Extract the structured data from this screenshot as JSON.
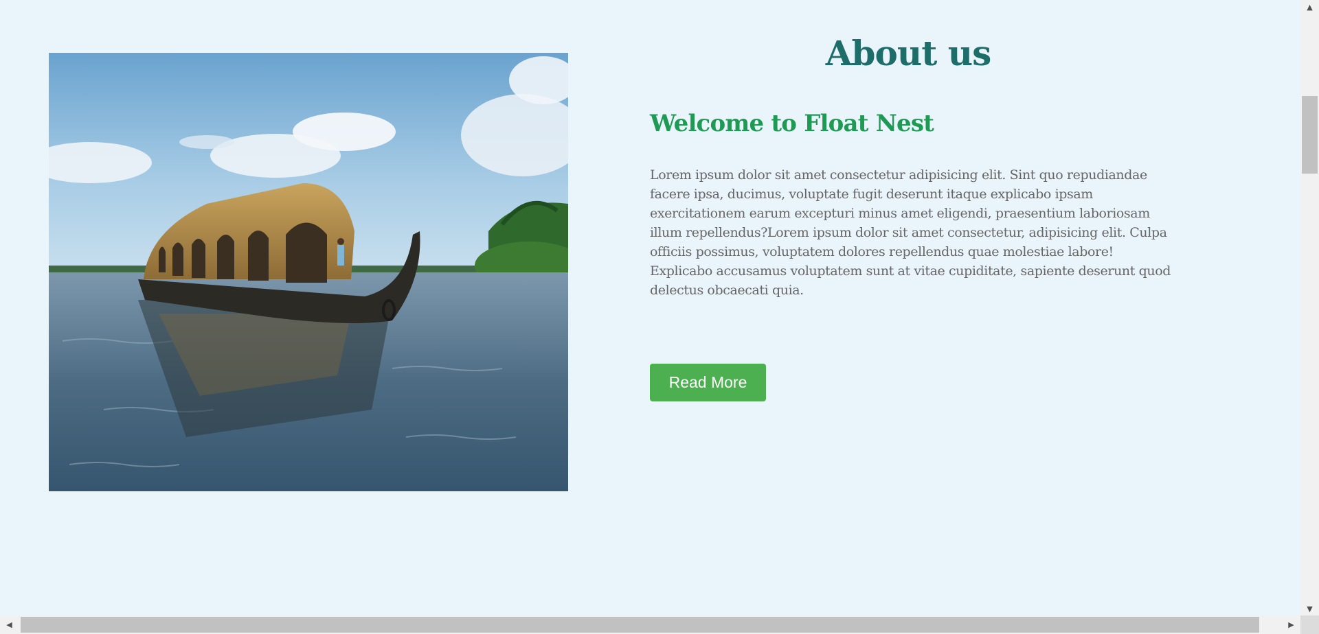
{
  "about": {
    "title": "About us",
    "welcome_heading": "Welcome to Float Nest",
    "text": "Lorem ipsum dolor sit amet consectetur adipisicing elit. Sint quo repudiandae facere ipsa, ducimus, voluptate fugit deserunt itaque explicabo ipsam exercitationem earum excepturi minus amet eligendi, praesentium laboriosam illum repellendus?Lorem ipsum dolor sit amet consectetur, adipisicing elit. Culpa officiis possimus, voluptatem dolores repellendus quae molestiae labore! Explicabo accusamus voluptatem sunt at vitae cupiditate, sapiente deserunt quod delectus obcaecati quia.",
    "button_label": "Read More",
    "image_icon": "houseboat-on-backwaters-photo"
  },
  "colors": {
    "page_background": "#eaf4fb",
    "title": "#1d6e6a",
    "welcome_heading": "#1f9a55",
    "body_text": "#666666",
    "button": "#4caf50"
  },
  "scrollbars": {
    "up_arrow_icon": "▲",
    "down_arrow_icon": "▼",
    "left_arrow_icon": "◀",
    "right_arrow_icon": "▶"
  }
}
